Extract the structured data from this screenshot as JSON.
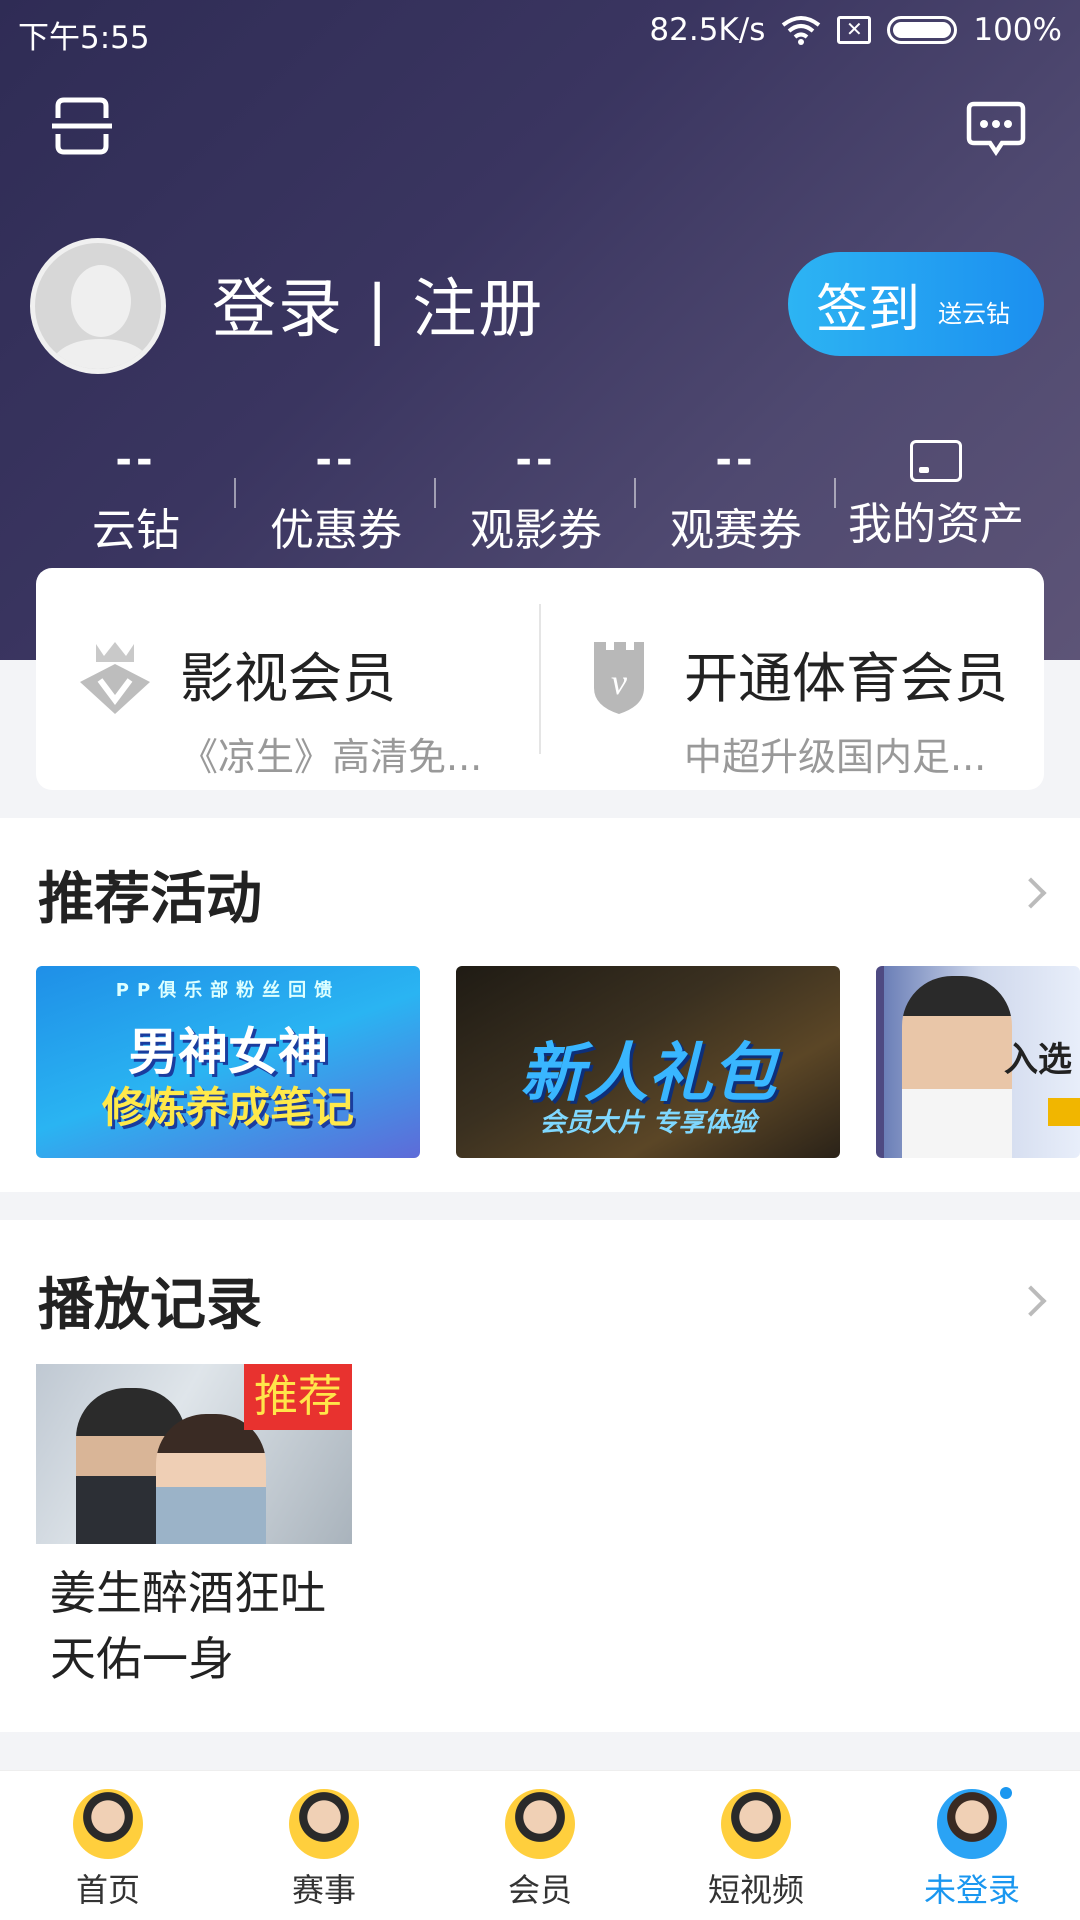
{
  "status_bar": {
    "time": "下午5:55",
    "speed": "82.5K/s",
    "battery": "100%"
  },
  "header": {
    "login_label": "登录 | 注册",
    "checkin": {
      "label": "签到",
      "sub": "送云钻"
    }
  },
  "stats": [
    {
      "value": "--",
      "label": "云钻"
    },
    {
      "value": "--",
      "label": "优惠券"
    },
    {
      "value": "--",
      "label": "观影券"
    },
    {
      "value": "--",
      "label": "观赛券"
    },
    {
      "value": "",
      "label": "我的资产"
    }
  ],
  "vip": [
    {
      "title": "影视会员",
      "subtitle": "《凉生》高清免..."
    },
    {
      "title": "开通体育会员",
      "subtitle": "中超升级国内足..."
    }
  ],
  "activities": {
    "title": "推荐活动",
    "banners": [
      {
        "line1": "PP俱乐部粉丝回馈",
        "line2": "男神女神",
        "line3": "修炼养成笔记"
      },
      {
        "line2": "新人礼包",
        "line3": "会员大片 专享体验"
      },
      {
        "line2": "入选"
      }
    ]
  },
  "history": {
    "title": "播放记录",
    "badge": "推荐",
    "caption": "姜生醉酒狂吐天佑一身"
  },
  "tabs": [
    {
      "label": "首页"
    },
    {
      "label": "赛事"
    },
    {
      "label": "会员"
    },
    {
      "label": "短视频"
    },
    {
      "label": "未登录"
    }
  ]
}
